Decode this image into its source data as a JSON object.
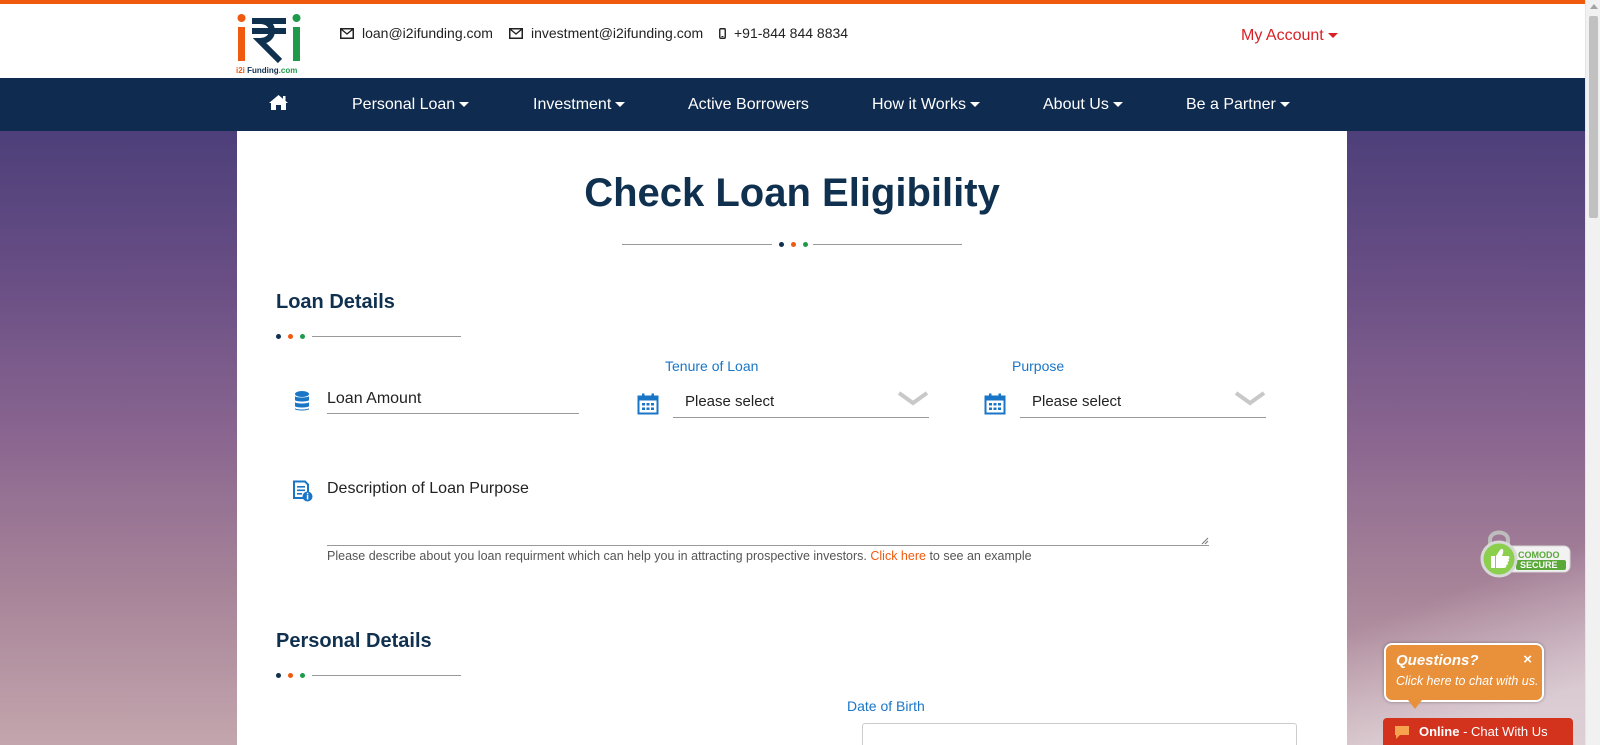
{
  "header": {
    "brand_text": {
      "part1": "i2i ",
      "part2": "Funding",
      "part3": ".com"
    },
    "email_loan": "loan@i2ifunding.com",
    "email_investment": "investment@i2ifunding.com",
    "phone": "+91-844 844 8834",
    "my_account": "My Account"
  },
  "nav": {
    "items": [
      {
        "label": "Personal Loan"
      },
      {
        "label": "Investment"
      },
      {
        "label": "Active Borrowers"
      },
      {
        "label": "How it Works"
      },
      {
        "label": "About Us"
      },
      {
        "label": "Be a Partner"
      }
    ]
  },
  "main": {
    "title": "Check Loan Eligibility",
    "loan_details": {
      "title": "Loan Details",
      "loan_amount_placeholder": "Loan Amount",
      "tenure_label": "Tenure of Loan",
      "tenure_value": "Please select",
      "purpose_label": "Purpose",
      "purpose_value": "Please select",
      "description_placeholder": "Description of Loan Purpose",
      "help_text": "Please describe about you loan requirment which can help you in attracting prospective investors.",
      "help_link": "Click here",
      "help_suffix": "to see an example"
    },
    "personal_details": {
      "title": "Personal Details",
      "dob_label": "Date of Birth"
    }
  },
  "badges": {
    "secure_line1": "COMODO",
    "secure_line2": "SECURE"
  },
  "chat": {
    "question": "Questions?",
    "subtitle": "Click here to chat with us.",
    "close": "×",
    "status": "Online",
    "bar_text": " - Chat With Us"
  },
  "colors": {
    "navy": "#0f2b4f",
    "orange": "#f05a0e",
    "green": "#1e9a4a",
    "link_blue": "#1976c7",
    "account_red": "#d91f26"
  }
}
